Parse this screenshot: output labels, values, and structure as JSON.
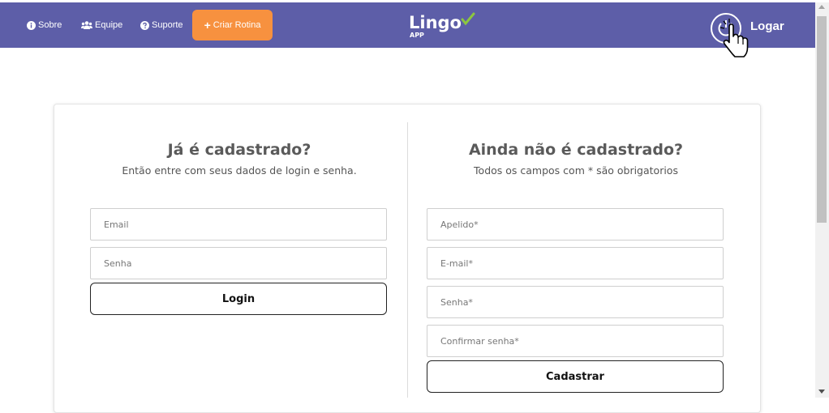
{
  "colors": {
    "navbar": "#5d5ea8",
    "accent": "#f7913f",
    "logo_check": "#8cc63f"
  },
  "nav": {
    "items": [
      {
        "icon": "info-circle-icon",
        "label": "Sobre"
      },
      {
        "icon": "users-icon",
        "label": "Equipe"
      },
      {
        "icon": "question-circle-icon",
        "label": "Suporte"
      }
    ],
    "cta": {
      "icon": "plus-icon",
      "label": "Criar Rotina"
    },
    "logo": {
      "word": "Lingo",
      "sub": "APP"
    },
    "login": {
      "icon": "power-icon",
      "label": "Logar"
    }
  },
  "login_form": {
    "title": "Já é cadastrado?",
    "subtitle": "Então entre com seus dados de login e senha.",
    "email_placeholder": "Email",
    "password_placeholder": "Senha",
    "submit_label": "Login"
  },
  "signup_form": {
    "title": "Ainda não é cadastrado?",
    "subtitle": "Todos os campos com * são obrigatorios",
    "nickname_placeholder": "Apelido*",
    "email_placeholder": "E-mail*",
    "password_placeholder": "Senha*",
    "confirm_placeholder": "Confirmar senha*",
    "submit_label": "Cadastrar"
  }
}
